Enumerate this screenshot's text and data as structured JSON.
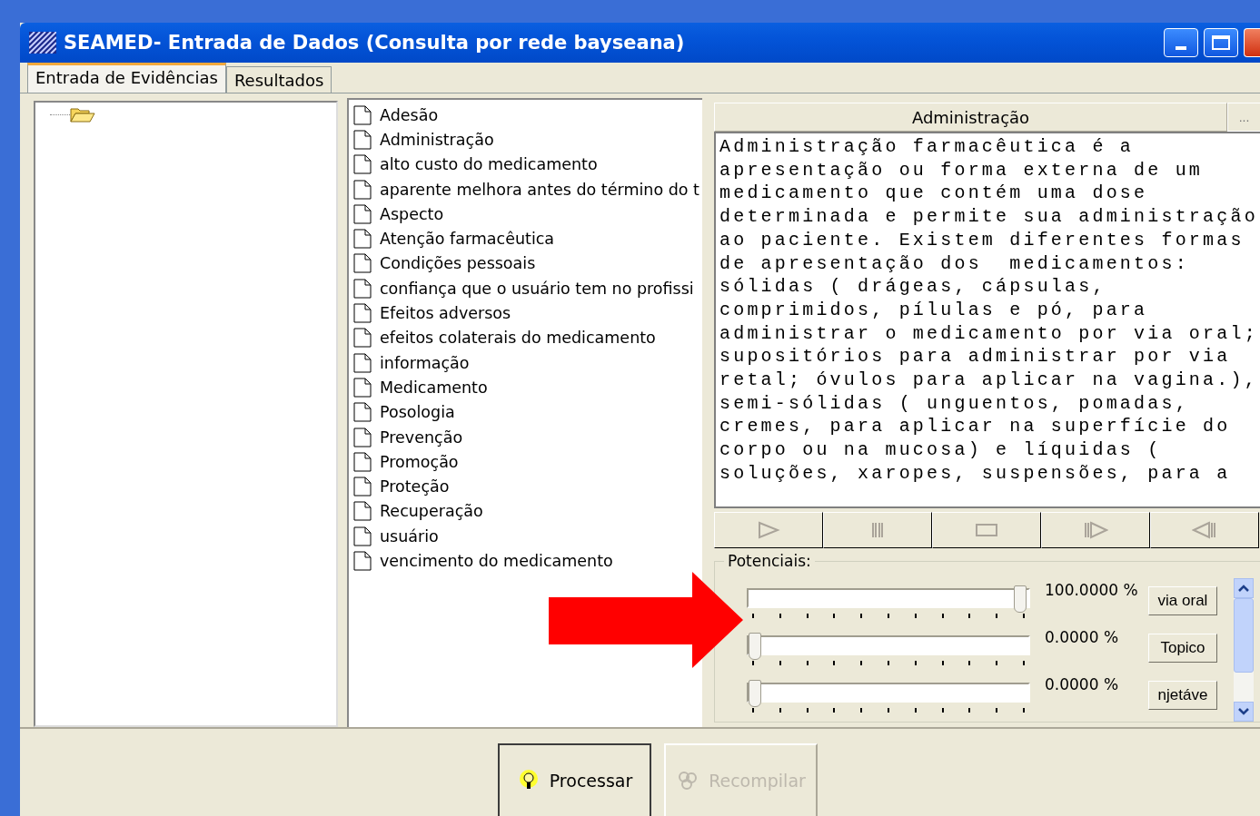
{
  "window": {
    "title": "SEAMED- Entrada de Dados (Consulta por rede bayseana)"
  },
  "tabs": [
    {
      "label": "Entrada de Evidências",
      "selected": true
    },
    {
      "label": "Resultados",
      "selected": false
    }
  ],
  "items": [
    "Adesão",
    "Administração",
    "alto custo do medicamento",
    "aparente melhora antes do término do t",
    "Aspecto",
    "Atenção farmacêutica",
    "Condições pessoais",
    "confiança que o usuário tem no profissi",
    "Efeitos adversos",
    "efeitos colaterais do medicamento",
    "informação",
    "Medicamento",
    "Posologia",
    "Prevenção",
    "Promoção",
    "Proteção",
    "Recuperação",
    "usuário",
    "vencimento do medicamento"
  ],
  "detail": {
    "title": "Administração",
    "more_button": "...",
    "text_lines": [
      "Administração farmacêutica é a",
      "apresentação ou forma externa de um",
      "medicamento que contém uma dose",
      "determinada e permite sua administração",
      "ao paciente. Existem diferentes formas",
      "de apresentação dos  medicamentos:",
      "sólidas ( drágeas, cápsulas,",
      "comprimidos, pílulas e pó, para",
      "administrar o medicamento por via oral;",
      "supositórios para administrar por via",
      "retal; óvulos para aplicar na vagina.),",
      "semi-sólidas ( unguentos, pomadas,",
      "cremes, para aplicar na superfície do",
      "corpo ou na mucosa) e líquidas (",
      "soluções, xaropes, suspensões, para a"
    ]
  },
  "media_buttons": [
    {
      "kind": "play"
    },
    {
      "kind": "pause"
    },
    {
      "kind": "stop"
    },
    {
      "kind": "step"
    },
    {
      "kind": "back"
    }
  ],
  "potentials": {
    "title": "Potenciais:",
    "rows": [
      {
        "level": 1,
        "reading": "100.0000 %",
        "label": "via oral"
      },
      {
        "level": 0,
        "reading": "0.0000 %",
        "label": "Topico"
      },
      {
        "level": 0,
        "reading": "0.0000 %",
        "label": "njetáve"
      }
    ]
  },
  "buttons": [
    {
      "label": "Processar",
      "disabled": false
    },
    {
      "label": "Recompilar",
      "disabled": true
    }
  ]
}
